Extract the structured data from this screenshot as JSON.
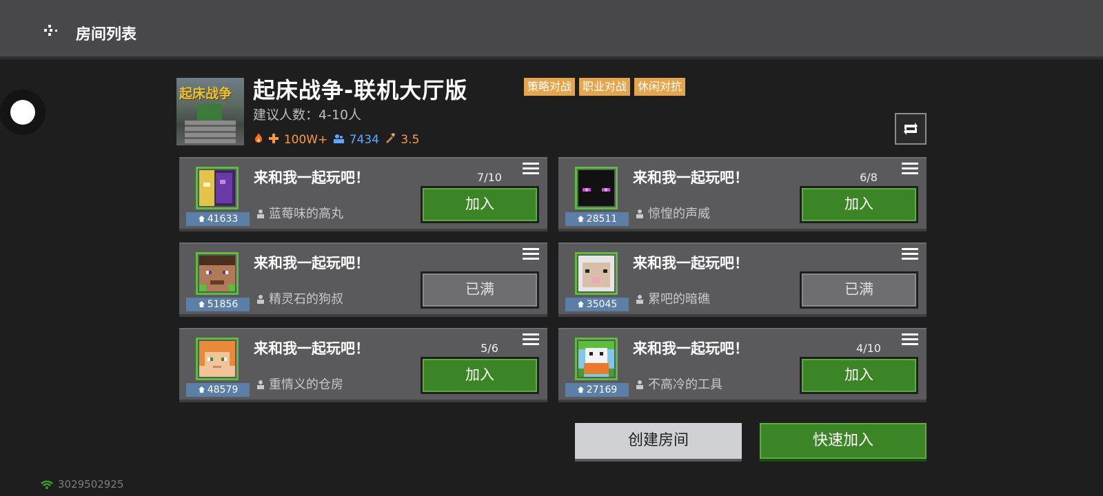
{
  "header": {
    "title": "房间列表"
  },
  "game": {
    "logo_text": "起床战争",
    "title": "起床战争-联机大厅版",
    "tags": [
      "策略对战",
      "职业对战",
      "休闲对抗"
    ],
    "recommended_players": "建议人数：4-10人",
    "stats": {
      "popularity": "100W+",
      "online": "7434",
      "rating": "3.5"
    }
  },
  "rooms": [
    {
      "id": "41633",
      "name": "来和我一起玩吧！",
      "host": "蓝莓味的高丸",
      "count": "7/10",
      "button": "加入",
      "status": "join"
    },
    {
      "id": "28511",
      "name": "来和我一起玩吧！",
      "host": "惊惶的声威",
      "count": "6/8",
      "button": "加入",
      "status": "join"
    },
    {
      "id": "51856",
      "name": "来和我一起玩吧！",
      "host": "精灵石的狗叔",
      "count": "",
      "button": "已满",
      "status": "full"
    },
    {
      "id": "35045",
      "name": "来和我一起玩吧！",
      "host": "累吧的暗礁",
      "count": "",
      "button": "已满",
      "status": "full"
    },
    {
      "id": "48579",
      "name": "来和我一起玩吧！",
      "host": "重情义的仓房",
      "count": "5/6",
      "button": "加入",
      "status": "join"
    },
    {
      "id": "27169",
      "name": "来和我一起玩吧！",
      "host": "不高冷的工具",
      "count": "4/10",
      "button": "加入",
      "status": "join"
    }
  ],
  "actions": {
    "create_room": "创建房间",
    "quick_join": "快速加入"
  },
  "footer": {
    "network_id": "3029502925"
  },
  "colors": {
    "accent_green": "#3c8527",
    "tag_orange": "#e4a54c",
    "id_badge_blue": "#5b7fa6"
  },
  "icons": [
    "back-icon",
    "fire-icon",
    "plus-icon",
    "people-icon",
    "score-icon",
    "refresh-icon",
    "menu-icon",
    "house-icon",
    "person-icon",
    "wifi-icon"
  ]
}
